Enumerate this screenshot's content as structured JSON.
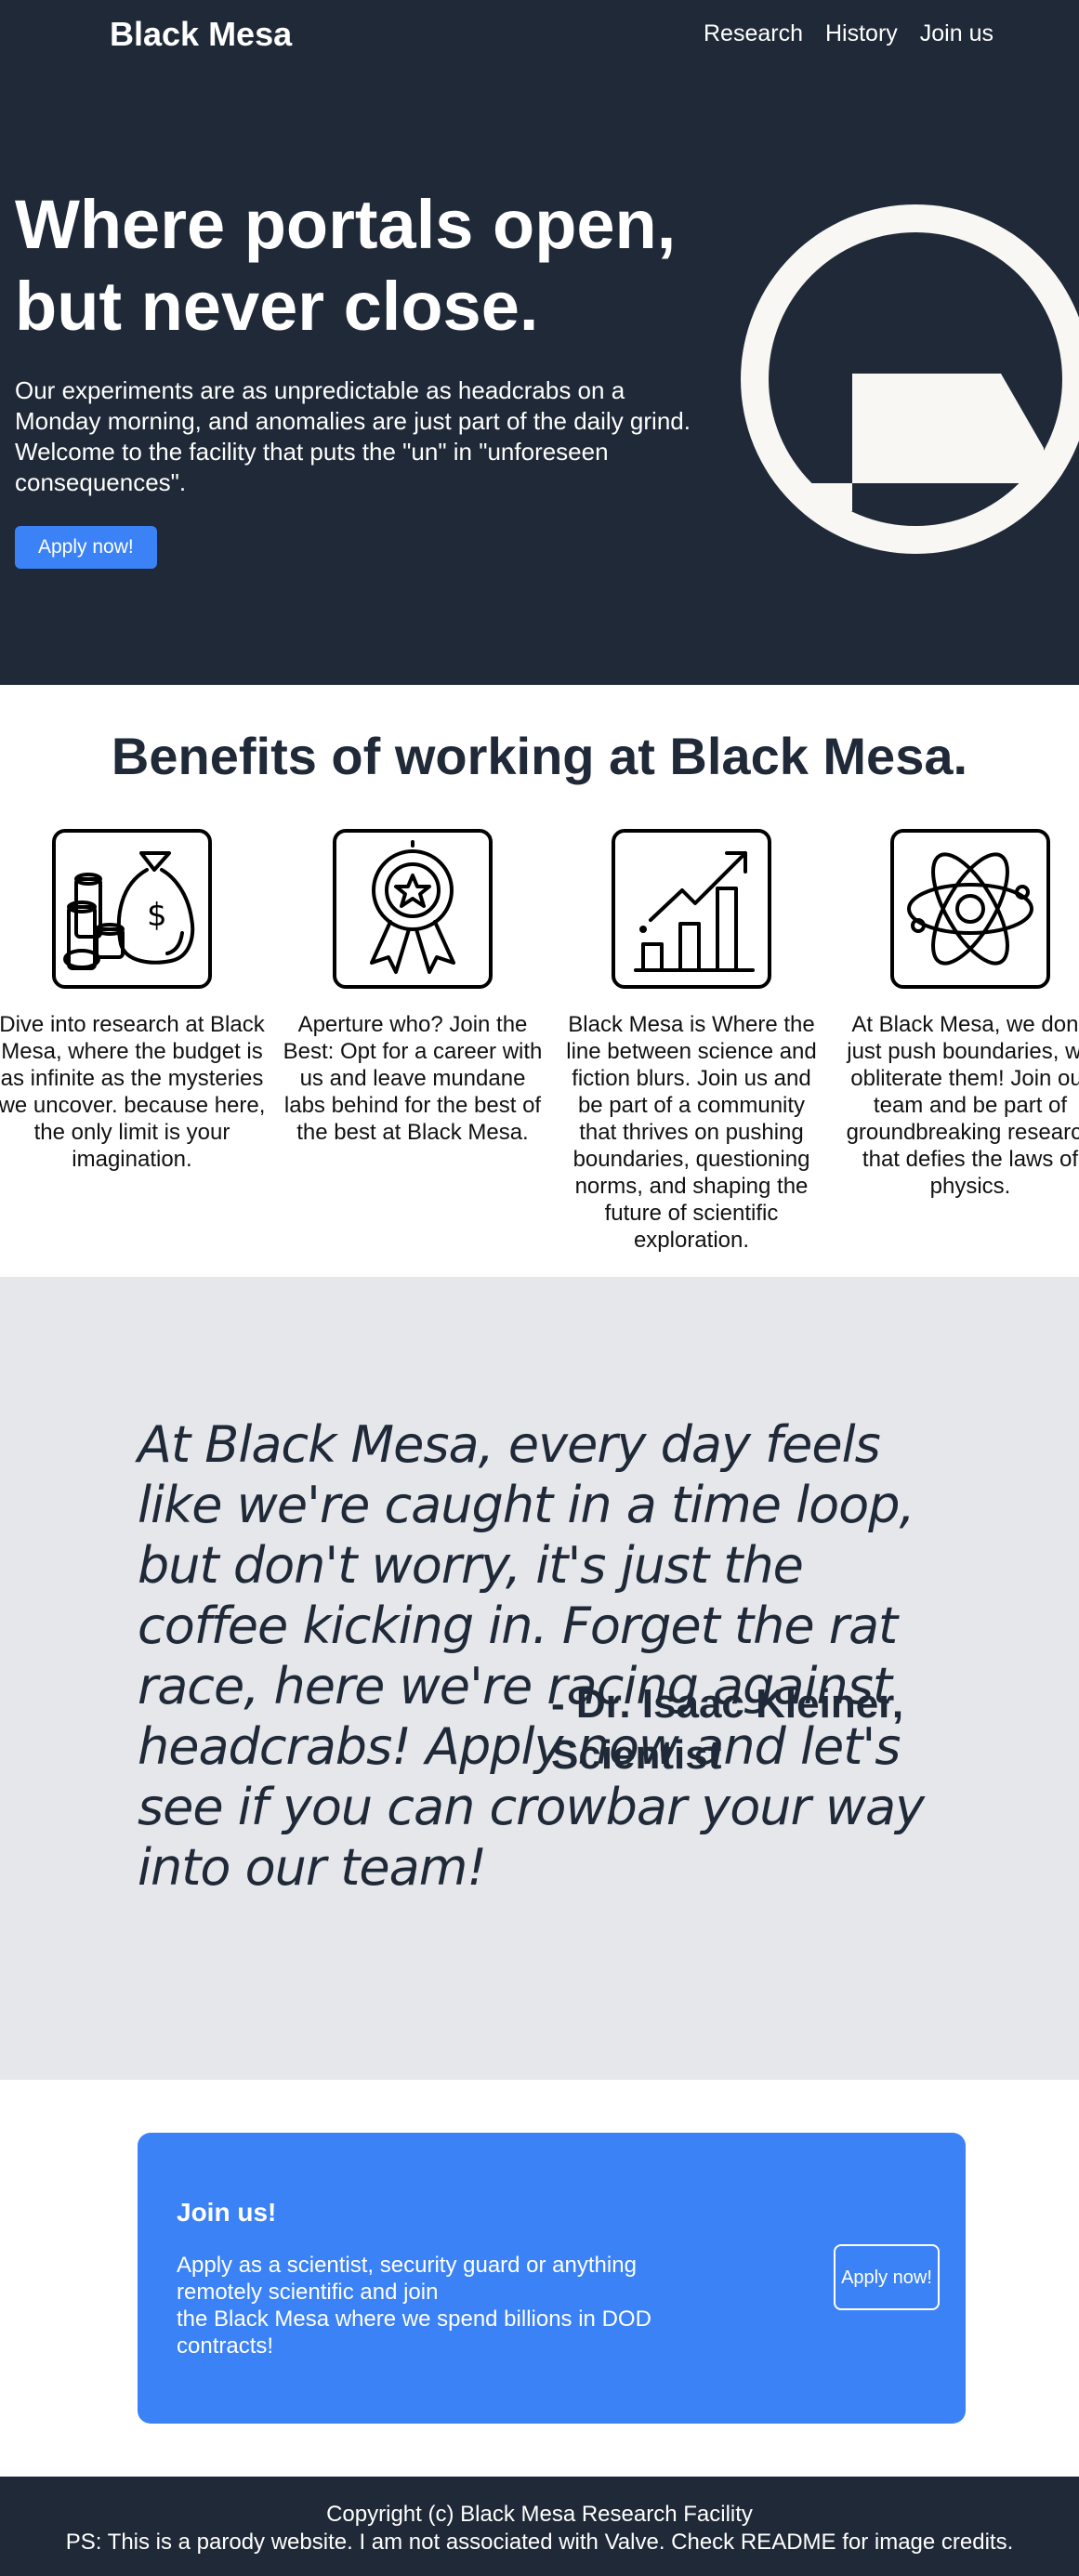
{
  "nav": {
    "brand": "Black Mesa",
    "links": [
      "Research",
      "History",
      "Join us"
    ]
  },
  "hero": {
    "title_line1": "Where portals open,",
    "title_line2": "but never close.",
    "description": "Our experiments are as unpredictable as headcrabs on a Monday morning, and anomalies are just part of the daily grind. Welcome to the facility that puts the \"un\" in \"unforeseen consequences\".",
    "cta": "Apply now!"
  },
  "benefits": {
    "title": "Benefits of working at Black Mesa.",
    "items": [
      {
        "icon": "money-bag-icon",
        "text": "Dive into research at Black Mesa, where the budget is as infinite as the mysteries we uncover. because here, the only limit is your imagination."
      },
      {
        "icon": "award-ribbon-icon",
        "text": "Aperture who? Join the Best: Opt for a career with us and leave mundane labs behind for the best of the best at Black Mesa."
      },
      {
        "icon": "growth-chart-icon",
        "text": "Black Mesa is Where the line between science and fiction blurs. Join us and be part of a community that thrives on pushing boundaries, questioning norms, and shaping the future of scientific exploration."
      },
      {
        "icon": "atom-icon",
        "text": "At Black Mesa, we don't just push boundaries, we obliterate them! Join our team and be part of groundbreaking research that defies the laws of physics."
      }
    ]
  },
  "quote": {
    "text": "At Black Mesa, every day feels like we're caught in a time loop, but don't worry, it's just the coffee kicking in. Forget the rat race, here we're racing against headcrabs! Apply now and let's see if you can crowbar your way into our team!",
    "author": "- Dr. Isaac Kleiner, Scientist"
  },
  "join": {
    "title": "Join us!",
    "description_line1": "Apply as a scientist, security guard or anything remotely scientific and join",
    "description_line2": "the Black Mesa where we spend billions in DOD contracts!",
    "button": "Apply now!"
  },
  "footer": {
    "copyright": "Copyright (c) Black Mesa Research Facility",
    "note": "PS: This is a parody website. I am not associated with Valve. Check README for image credits."
  },
  "colors": {
    "dark": "#1f2937",
    "accent": "#3b82f6",
    "light_gray": "#e5e7eb",
    "logo_white": "#f8f7f4"
  }
}
